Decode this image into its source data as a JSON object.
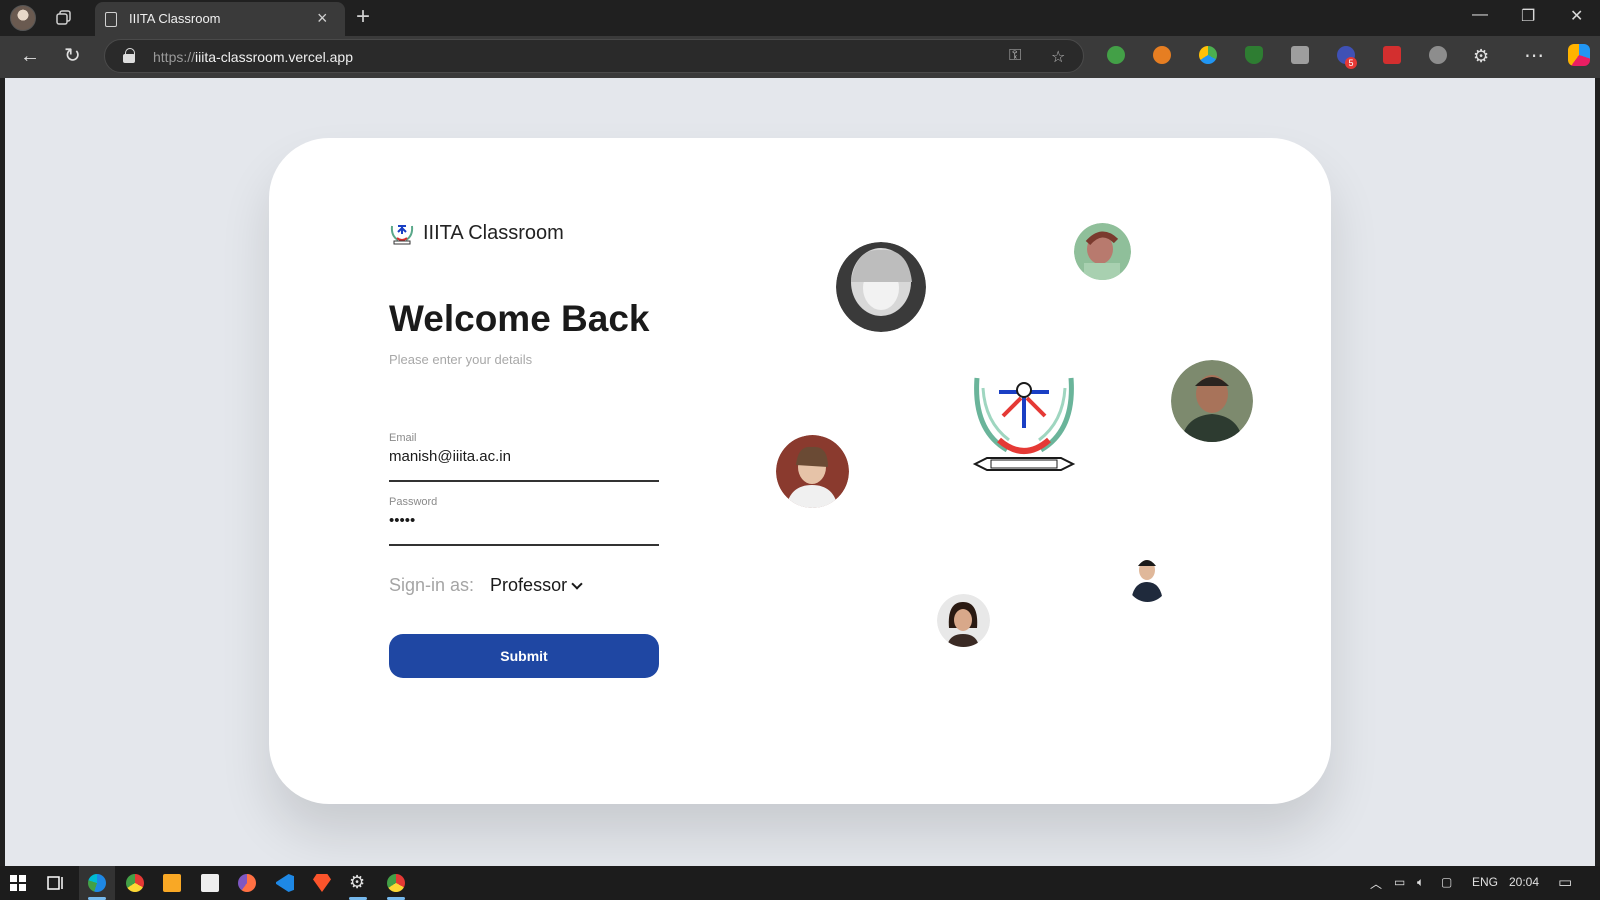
{
  "browser": {
    "tab_title": "IIITA Classroom",
    "url_scheme": "https://",
    "url_host": "iiita-classroom.vercel.app",
    "extension_badge": "5"
  },
  "page": {
    "brand_name": "IIITA Classroom",
    "heading": "Welcome Back",
    "subtitle": "Please enter your details",
    "email_label": "Email",
    "email_value": "manish@iiita.ac.in",
    "password_label": "Password",
    "password_value": "•••••",
    "signin_label": "Sign-in as:",
    "role_value": "Professor",
    "submit_label": "Submit"
  },
  "taskbar": {
    "language": "ENG",
    "time": "20:04"
  },
  "colors": {
    "accent": "#1f47a3",
    "page_bg": "#e4e7ec",
    "card_bg": "#ffffff"
  }
}
